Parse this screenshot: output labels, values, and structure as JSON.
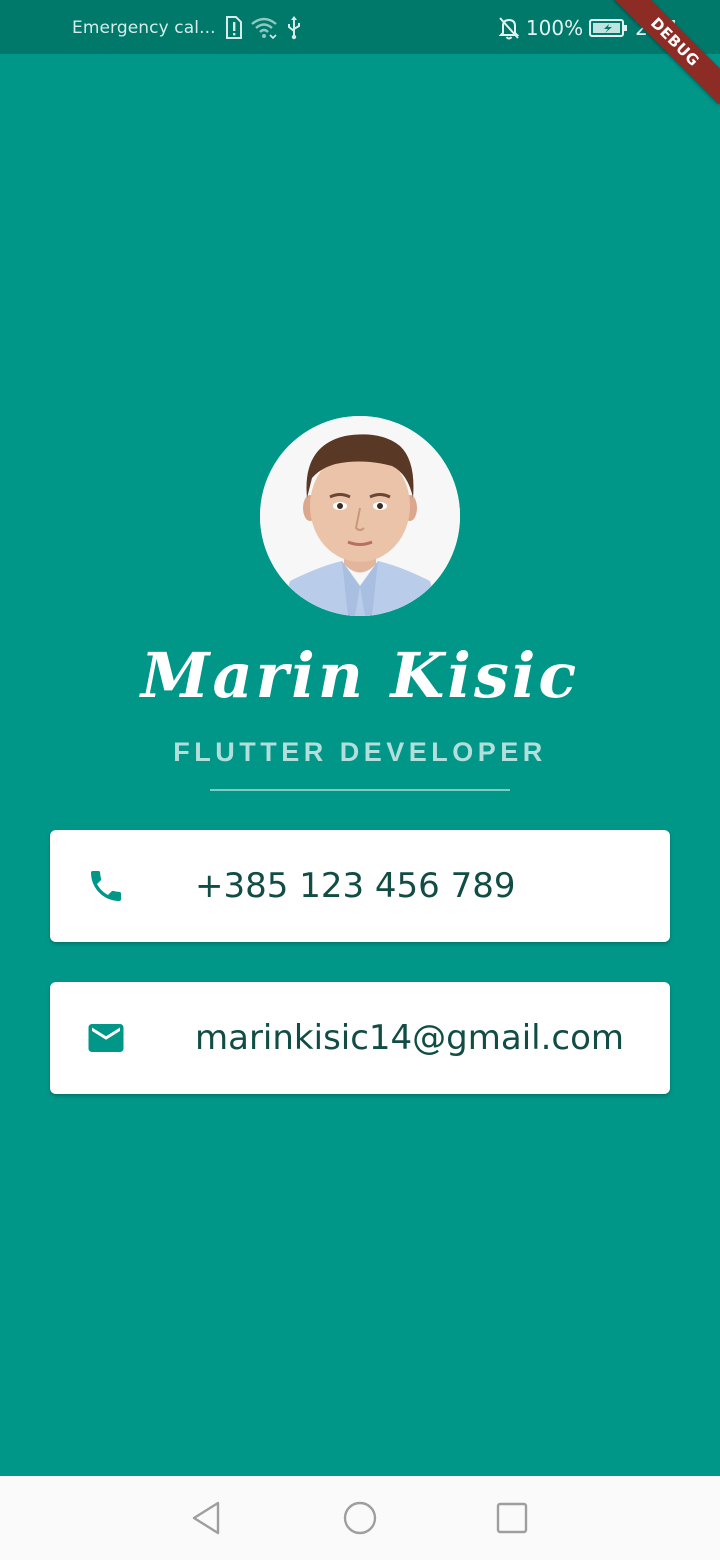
{
  "status_bar": {
    "carrier_text": "Emergency cal...",
    "battery_percent": "100%",
    "time": "2:21",
    "icons": [
      "sim-alert-icon",
      "wifi-icon",
      "usb-icon",
      "notifications-off-icon",
      "battery-charging-icon"
    ]
  },
  "debug_banner": {
    "label": "DEBUG"
  },
  "profile": {
    "name": "Marin Kisic",
    "title": "FLUTTER DEVELOPER"
  },
  "contacts": {
    "phone": {
      "icon": "phone-icon",
      "value": "+385 123 456 789"
    },
    "email": {
      "icon": "email-icon",
      "value": "marinkisic14@gmail.com"
    }
  },
  "navigation": {
    "buttons": [
      "back-icon",
      "home-icon",
      "recents-icon"
    ]
  },
  "colors": {
    "background": "#009688",
    "status_bar": "#00796b",
    "card": "#ffffff",
    "card_text": "#114d45",
    "icon": "#009688",
    "subtitle": "#b2dfdb",
    "debug_banner": "#8d2b25"
  }
}
